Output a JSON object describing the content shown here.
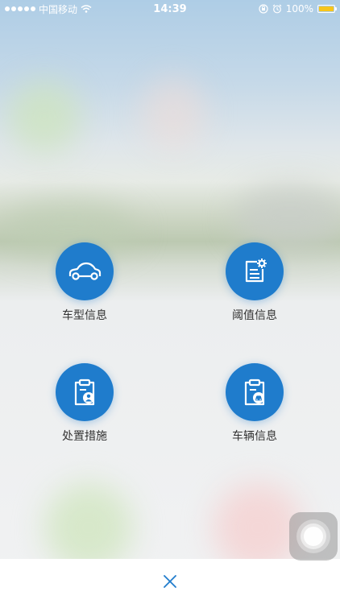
{
  "status_bar": {
    "carrier": "中国移动",
    "time": "14:39",
    "battery_percent": "100%",
    "battery_level": 1.0,
    "battery_color": "#f7c51b"
  },
  "menu": {
    "accent_color": "#1f7ccc",
    "items": [
      {
        "label": "车型信息",
        "icon": "car-icon"
      },
      {
        "label": "阈值信息",
        "icon": "document-settings-icon"
      },
      {
        "label": "处置措施",
        "icon": "clipboard-user-icon"
      },
      {
        "label": "车辆信息",
        "icon": "clipboard-car-icon"
      }
    ]
  },
  "bottom_bar": {
    "close_icon": "close-icon"
  }
}
